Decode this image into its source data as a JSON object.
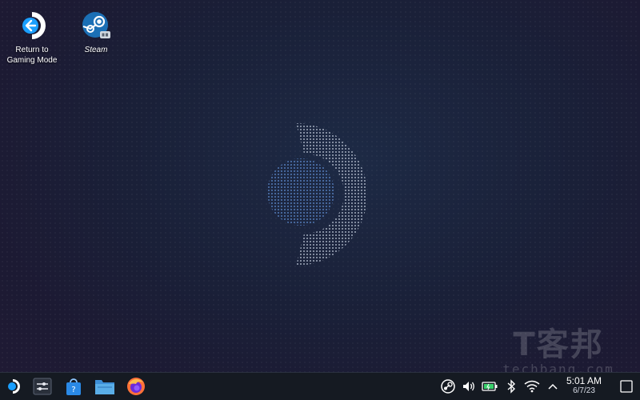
{
  "desktop": {
    "icons": [
      {
        "label_line1": "Return to",
        "label_line2": "Gaming Mode",
        "icon": "steamdeck-return-icon"
      },
      {
        "label": "Steam",
        "icon": "steam-icon"
      }
    ]
  },
  "watermark": {
    "brand": "T客邦",
    "url": "techbang.com"
  },
  "taskbar": {
    "launchers": [
      "steamdeck-launcher-icon",
      "system-settings-icon",
      "discover-store-icon",
      "file-manager-icon",
      "firefox-icon"
    ],
    "tray": [
      "steam-tray-icon",
      "volume-icon",
      "battery-icon",
      "bluetooth-icon",
      "wifi-icon",
      "chevron-up-icon"
    ],
    "clock": {
      "time": "5:01 AM",
      "date": "6/7/23"
    }
  },
  "colors": {
    "accent": "#1a9fff",
    "taskbar_bg": "#151a22",
    "desktop_bg": "#1c2136"
  }
}
